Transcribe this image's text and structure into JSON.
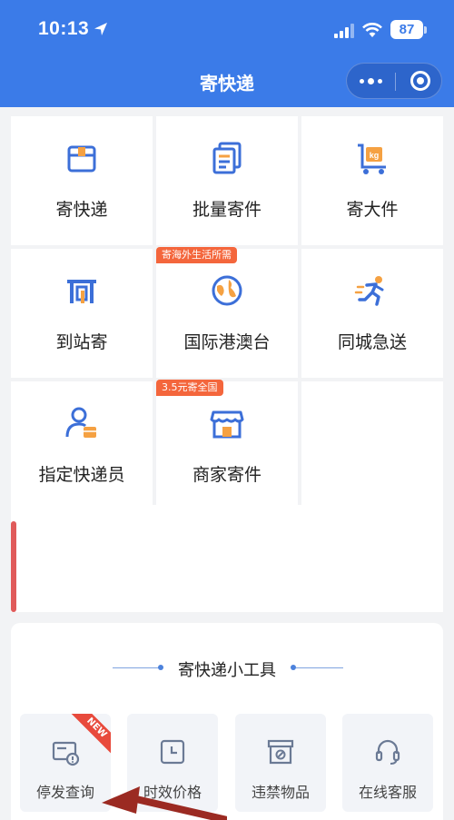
{
  "status": {
    "time": "10:13",
    "battery": "87"
  },
  "header": {
    "title": "寄快递"
  },
  "grid": [
    {
      "label": "寄快递",
      "icon": "box-icon",
      "tag": ""
    },
    {
      "label": "批量寄件",
      "icon": "documents-icon",
      "tag": ""
    },
    {
      "label": "寄大件",
      "icon": "kg-cart-icon",
      "tag": ""
    },
    {
      "label": "到站寄",
      "icon": "station-icon",
      "tag": ""
    },
    {
      "label": "国际港澳台",
      "icon": "globe-icon",
      "tag": "寄海外生活所需"
    },
    {
      "label": "同城急送",
      "icon": "runner-icon",
      "tag": ""
    },
    {
      "label": "指定快递员",
      "icon": "courier-icon",
      "tag": ""
    },
    {
      "label": "商家寄件",
      "icon": "shop-icon",
      "tag": "3.5元寄全国"
    }
  ],
  "tools": {
    "title": "寄快递小工具",
    "items": [
      {
        "label": "停发查询",
        "icon": "suspension-query-icon",
        "badge": "NEW"
      },
      {
        "label": "时效价格",
        "icon": "clock-icon",
        "badge": ""
      },
      {
        "label": "违禁物品",
        "icon": "prohibited-box-icon",
        "badge": ""
      },
      {
        "label": "在线客服",
        "icon": "headset-icon",
        "badge": ""
      }
    ]
  },
  "colors": {
    "brand": "#3b7be8",
    "tag": "#f4663c",
    "icon_blue": "#3c6fd8",
    "icon_orange": "#f5a142"
  }
}
